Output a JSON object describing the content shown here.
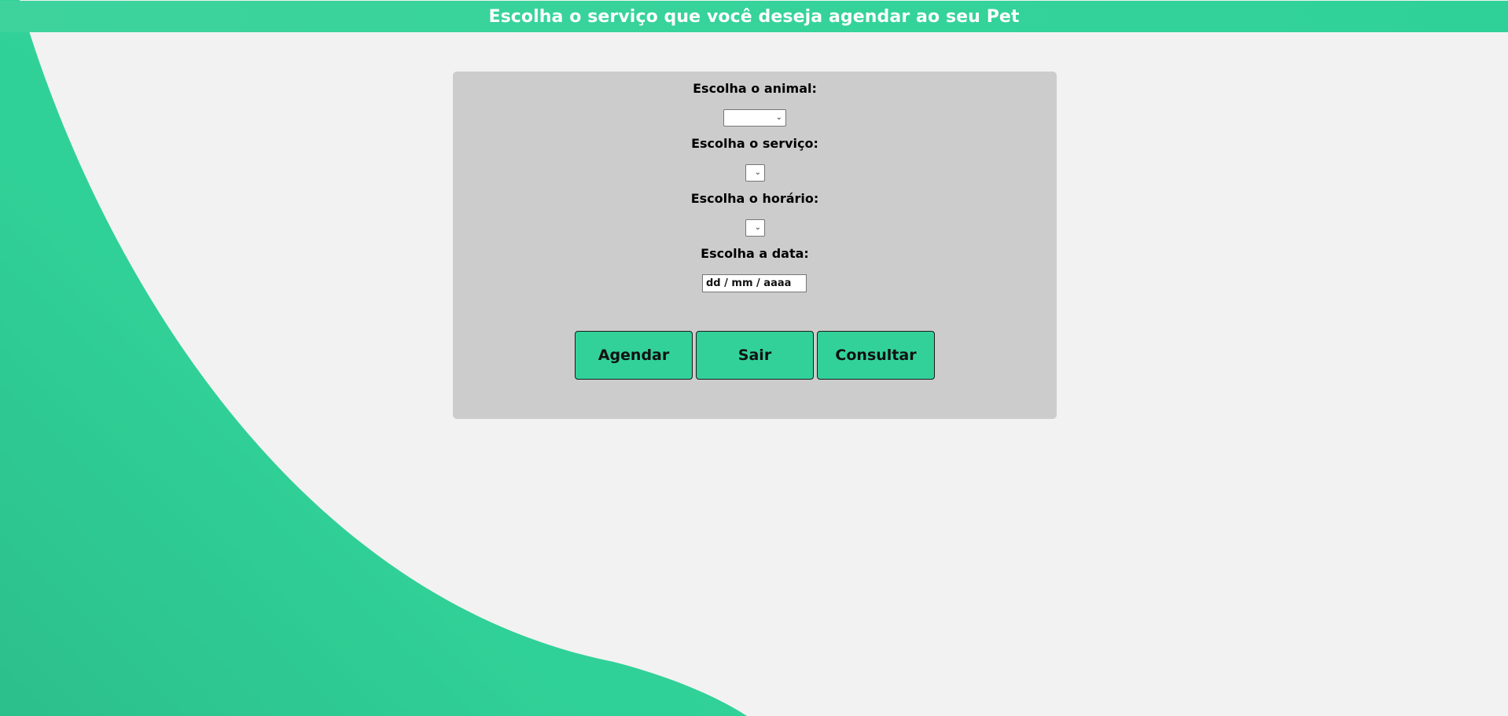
{
  "header": {
    "title": "Escolha o serviço que você deseja agendar ao seu Pet"
  },
  "form": {
    "animal_label": "Escolha o animal:",
    "animal_value": "",
    "service_label": "Escolha o serviço:",
    "service_value": "",
    "time_label": "Escolha o horário:",
    "time_value": "",
    "date_label": "Escolha a data:",
    "date_value": "dd / mm / aaaa"
  },
  "buttons": {
    "schedule_label": "Agendar",
    "exit_label": "Sair",
    "consult_label": "Consultar"
  },
  "colors": {
    "accent": "#32d19a",
    "background": "#f2f2f2",
    "panel": "#cccccc"
  },
  "icons": {
    "dropdown": "chevron-down-icon"
  }
}
